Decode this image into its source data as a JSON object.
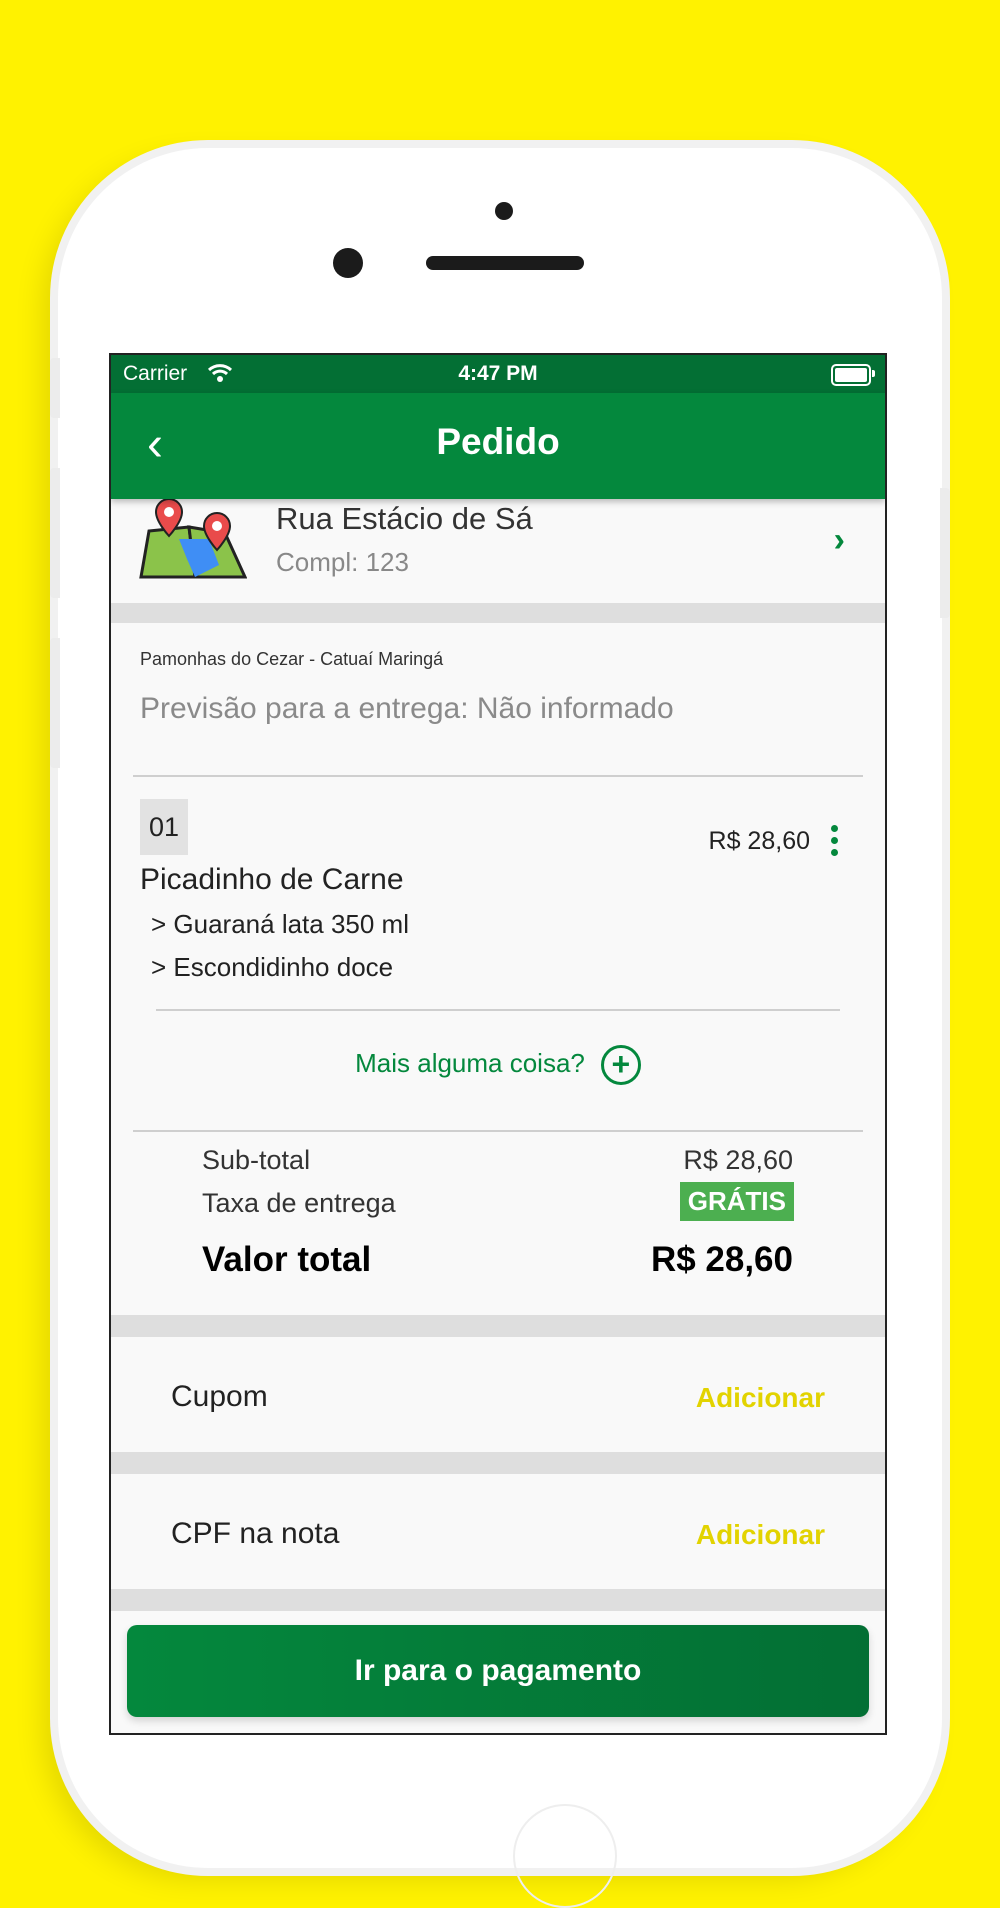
{
  "status_bar": {
    "carrier": "Carrier",
    "time": "4:47 PM"
  },
  "nav": {
    "title": "Pedido"
  },
  "address": {
    "street": "Rua Estácio de Sá",
    "complement": "Compl: 123"
  },
  "store": {
    "name": "Pamonhas do Cezar - Catuaí Maringá",
    "forecast": "Previsão para a entrega: Não informado"
  },
  "item": {
    "quantity": "01",
    "name": "Picadinho de Carne",
    "price": "R$ 28,60",
    "addons": [
      "> Guaraná lata 350 ml",
      "> Escondidinho doce"
    ]
  },
  "more_label": "Mais alguma coisa?",
  "summary": {
    "subtotal_label": "Sub-total",
    "subtotal_value": "R$ 28,60",
    "delivery_label": "Taxa de entrega",
    "delivery_value": "GRÁTIS",
    "total_label": "Valor total",
    "total_value": "R$ 28,60"
  },
  "coupon": {
    "label": "Cupom",
    "action": "Adicionar"
  },
  "cpf": {
    "label": "CPF na nota",
    "action": "Adicionar"
  },
  "pay_button": "Ir para o pagamento",
  "colors": {
    "primary": "#04883D",
    "primary_dark": "#036F34",
    "accent": "#E2D300",
    "background": "#FFF200",
    "free_badge": "#4CAF50"
  }
}
